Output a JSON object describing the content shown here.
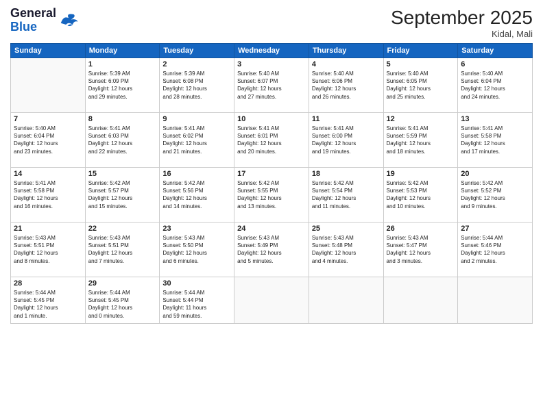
{
  "header": {
    "logo_line1": "General",
    "logo_line2": "Blue",
    "month_title": "September 2025",
    "location": "Kidal, Mali"
  },
  "weekdays": [
    "Sunday",
    "Monday",
    "Tuesday",
    "Wednesday",
    "Thursday",
    "Friday",
    "Saturday"
  ],
  "weeks": [
    [
      {
        "day": "",
        "info": ""
      },
      {
        "day": "1",
        "info": "Sunrise: 5:39 AM\nSunset: 6:09 PM\nDaylight: 12 hours\nand 29 minutes."
      },
      {
        "day": "2",
        "info": "Sunrise: 5:39 AM\nSunset: 6:08 PM\nDaylight: 12 hours\nand 28 minutes."
      },
      {
        "day": "3",
        "info": "Sunrise: 5:40 AM\nSunset: 6:07 PM\nDaylight: 12 hours\nand 27 minutes."
      },
      {
        "day": "4",
        "info": "Sunrise: 5:40 AM\nSunset: 6:06 PM\nDaylight: 12 hours\nand 26 minutes."
      },
      {
        "day": "5",
        "info": "Sunrise: 5:40 AM\nSunset: 6:05 PM\nDaylight: 12 hours\nand 25 minutes."
      },
      {
        "day": "6",
        "info": "Sunrise: 5:40 AM\nSunset: 6:04 PM\nDaylight: 12 hours\nand 24 minutes."
      }
    ],
    [
      {
        "day": "7",
        "info": "Sunrise: 5:40 AM\nSunset: 6:04 PM\nDaylight: 12 hours\nand 23 minutes."
      },
      {
        "day": "8",
        "info": "Sunrise: 5:41 AM\nSunset: 6:03 PM\nDaylight: 12 hours\nand 22 minutes."
      },
      {
        "day": "9",
        "info": "Sunrise: 5:41 AM\nSunset: 6:02 PM\nDaylight: 12 hours\nand 21 minutes."
      },
      {
        "day": "10",
        "info": "Sunrise: 5:41 AM\nSunset: 6:01 PM\nDaylight: 12 hours\nand 20 minutes."
      },
      {
        "day": "11",
        "info": "Sunrise: 5:41 AM\nSunset: 6:00 PM\nDaylight: 12 hours\nand 19 minutes."
      },
      {
        "day": "12",
        "info": "Sunrise: 5:41 AM\nSunset: 5:59 PM\nDaylight: 12 hours\nand 18 minutes."
      },
      {
        "day": "13",
        "info": "Sunrise: 5:41 AM\nSunset: 5:58 PM\nDaylight: 12 hours\nand 17 minutes."
      }
    ],
    [
      {
        "day": "14",
        "info": "Sunrise: 5:41 AM\nSunset: 5:58 PM\nDaylight: 12 hours\nand 16 minutes."
      },
      {
        "day": "15",
        "info": "Sunrise: 5:42 AM\nSunset: 5:57 PM\nDaylight: 12 hours\nand 15 minutes."
      },
      {
        "day": "16",
        "info": "Sunrise: 5:42 AM\nSunset: 5:56 PM\nDaylight: 12 hours\nand 14 minutes."
      },
      {
        "day": "17",
        "info": "Sunrise: 5:42 AM\nSunset: 5:55 PM\nDaylight: 12 hours\nand 13 minutes."
      },
      {
        "day": "18",
        "info": "Sunrise: 5:42 AM\nSunset: 5:54 PM\nDaylight: 12 hours\nand 11 minutes."
      },
      {
        "day": "19",
        "info": "Sunrise: 5:42 AM\nSunset: 5:53 PM\nDaylight: 12 hours\nand 10 minutes."
      },
      {
        "day": "20",
        "info": "Sunrise: 5:42 AM\nSunset: 5:52 PM\nDaylight: 12 hours\nand 9 minutes."
      }
    ],
    [
      {
        "day": "21",
        "info": "Sunrise: 5:43 AM\nSunset: 5:51 PM\nDaylight: 12 hours\nand 8 minutes."
      },
      {
        "day": "22",
        "info": "Sunrise: 5:43 AM\nSunset: 5:51 PM\nDaylight: 12 hours\nand 7 minutes."
      },
      {
        "day": "23",
        "info": "Sunrise: 5:43 AM\nSunset: 5:50 PM\nDaylight: 12 hours\nand 6 minutes."
      },
      {
        "day": "24",
        "info": "Sunrise: 5:43 AM\nSunset: 5:49 PM\nDaylight: 12 hours\nand 5 minutes."
      },
      {
        "day": "25",
        "info": "Sunrise: 5:43 AM\nSunset: 5:48 PM\nDaylight: 12 hours\nand 4 minutes."
      },
      {
        "day": "26",
        "info": "Sunrise: 5:43 AM\nSunset: 5:47 PM\nDaylight: 12 hours\nand 3 minutes."
      },
      {
        "day": "27",
        "info": "Sunrise: 5:44 AM\nSunset: 5:46 PM\nDaylight: 12 hours\nand 2 minutes."
      }
    ],
    [
      {
        "day": "28",
        "info": "Sunrise: 5:44 AM\nSunset: 5:45 PM\nDaylight: 12 hours\nand 1 minute."
      },
      {
        "day": "29",
        "info": "Sunrise: 5:44 AM\nSunset: 5:45 PM\nDaylight: 12 hours\nand 0 minutes."
      },
      {
        "day": "30",
        "info": "Sunrise: 5:44 AM\nSunset: 5:44 PM\nDaylight: 11 hours\nand 59 minutes."
      },
      {
        "day": "",
        "info": ""
      },
      {
        "day": "",
        "info": ""
      },
      {
        "day": "",
        "info": ""
      },
      {
        "day": "",
        "info": ""
      }
    ]
  ]
}
